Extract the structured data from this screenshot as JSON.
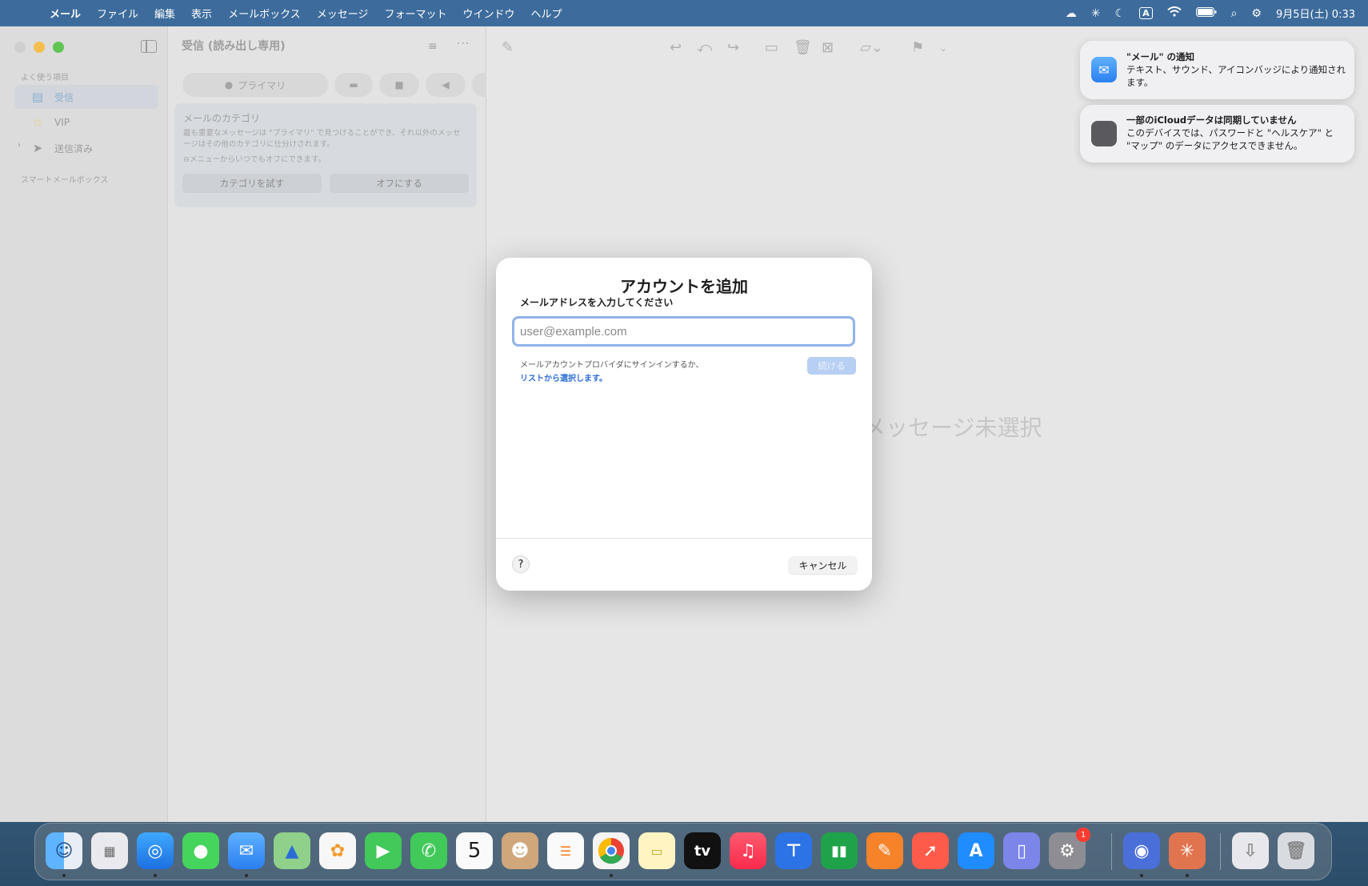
{
  "menubar": {
    "app_name": "メール",
    "items": [
      "ファイル",
      "編集",
      "表示",
      "メールボックス",
      "メッセージ",
      "フォーマット",
      "ウインドウ",
      "ヘルプ"
    ],
    "input_indicator": "A",
    "clock": "9月5日(土) 0:33"
  },
  "sidebar": {
    "favorites_label": "よく使う項目",
    "inbox_label": "受信",
    "vip_label": "VIP",
    "sent_label": "送信済み",
    "smart_label": "スマートメールボックス"
  },
  "message_list": {
    "title": "受信 (読み出し専用)",
    "primary_tab": "プライマリ",
    "category_card": {
      "heading": "メールのカテゴリ",
      "description": "最も重要なメッセージは \"プライマリ\" で見つけることができ、それ以外のメッセージはその他のカテゴリに仕分けされます。",
      "note": "⊖メニューからいつでもオフにできます。",
      "try_button": "カテゴリを試す",
      "off_button": "オフにする"
    }
  },
  "content": {
    "no_message": "メッセージ未選択"
  },
  "notifications": [
    {
      "title": "\"メール\" の通知",
      "body": "テキスト、サウンド、アイコンバッジにより通知されます。"
    },
    {
      "title": "一部のiCloudデータは同期していません",
      "body": "このデバイスでは、パスワードと \"ヘルスケア\" と \"マップ\" のデータにアクセスできません。"
    }
  ],
  "dialog": {
    "title": "アカウントを追加",
    "subtitle": "メールアドレスを入力してください",
    "email_placeholder": "user@example.com",
    "email_value": "",
    "help_text": "メールアカウントプロバイダにサインインするか、",
    "link_text": "リストから選択します。",
    "continue_label": "続ける",
    "help_button": "?",
    "cancel_label": "キャンセル"
  },
  "dock": {
    "calendar_day": "5",
    "settings_badge": "1",
    "tv_label": "tv"
  },
  "colors": {
    "menubar_bg": "#3d6c9c",
    "accent": "#2a6dd6",
    "input_focus": "#90b3ea",
    "traffic_yellow": "#f5bf4f",
    "traffic_green": "#61c554"
  }
}
